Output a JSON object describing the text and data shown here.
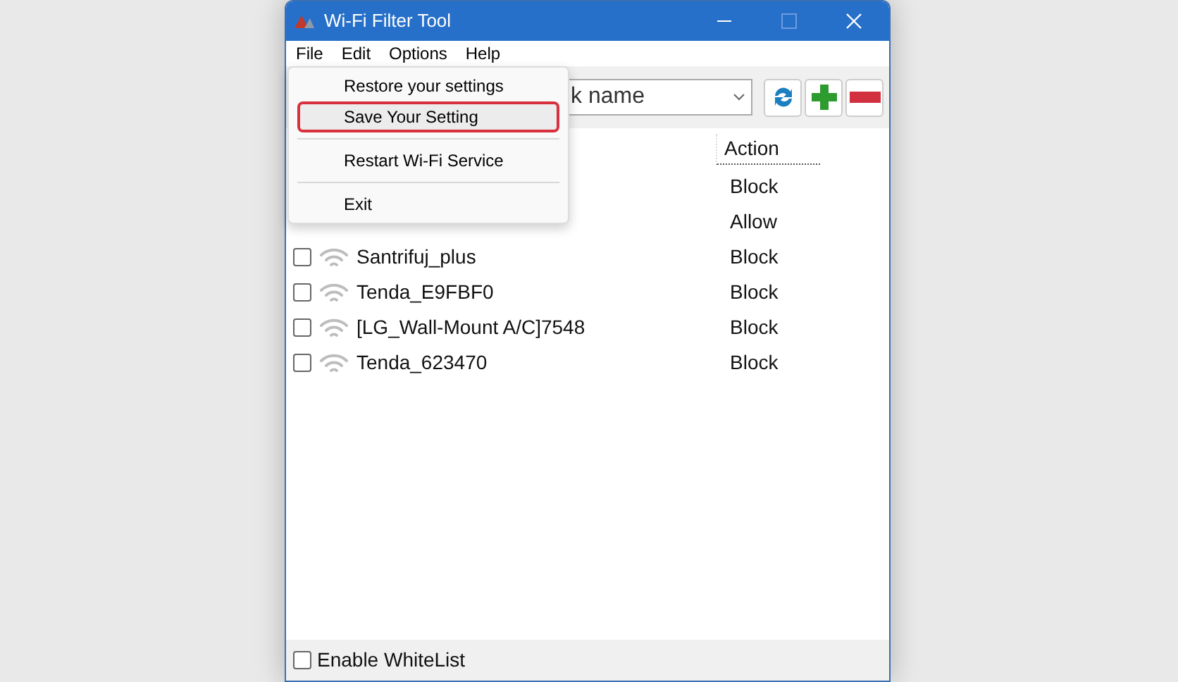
{
  "window": {
    "title": "Wi-Fi Filter Tool"
  },
  "menu_bar": [
    "File",
    "Edit",
    "Options",
    "Help"
  ],
  "file_menu": [
    {
      "label": "Restore your settings",
      "highlighted": false
    },
    {
      "label": "Save Your Setting",
      "highlighted": true
    },
    {
      "kind": "separator"
    },
    {
      "label": "Restart Wi-Fi Service",
      "highlighted": false
    },
    {
      "kind": "separator"
    },
    {
      "label": "Exit",
      "highlighted": false
    }
  ],
  "network_combo": {
    "value": "k name"
  },
  "list": {
    "columns": [
      "Action"
    ],
    "rows": [
      {
        "action": "Block"
      },
      {
        "action": "Allow"
      },
      {
        "name": "Santrifuj_plus",
        "checked": false,
        "action": "Block"
      },
      {
        "name": "Tenda_E9FBF0",
        "checked": false,
        "action": "Block"
      },
      {
        "name": "[LG_Wall-Mount A/C]7548",
        "checked": false,
        "action": "Block"
      },
      {
        "name": "Tenda_623470",
        "checked": false,
        "action": "Block"
      }
    ]
  },
  "whitelist": {
    "label": "Enable WhiteList",
    "checked": false
  }
}
